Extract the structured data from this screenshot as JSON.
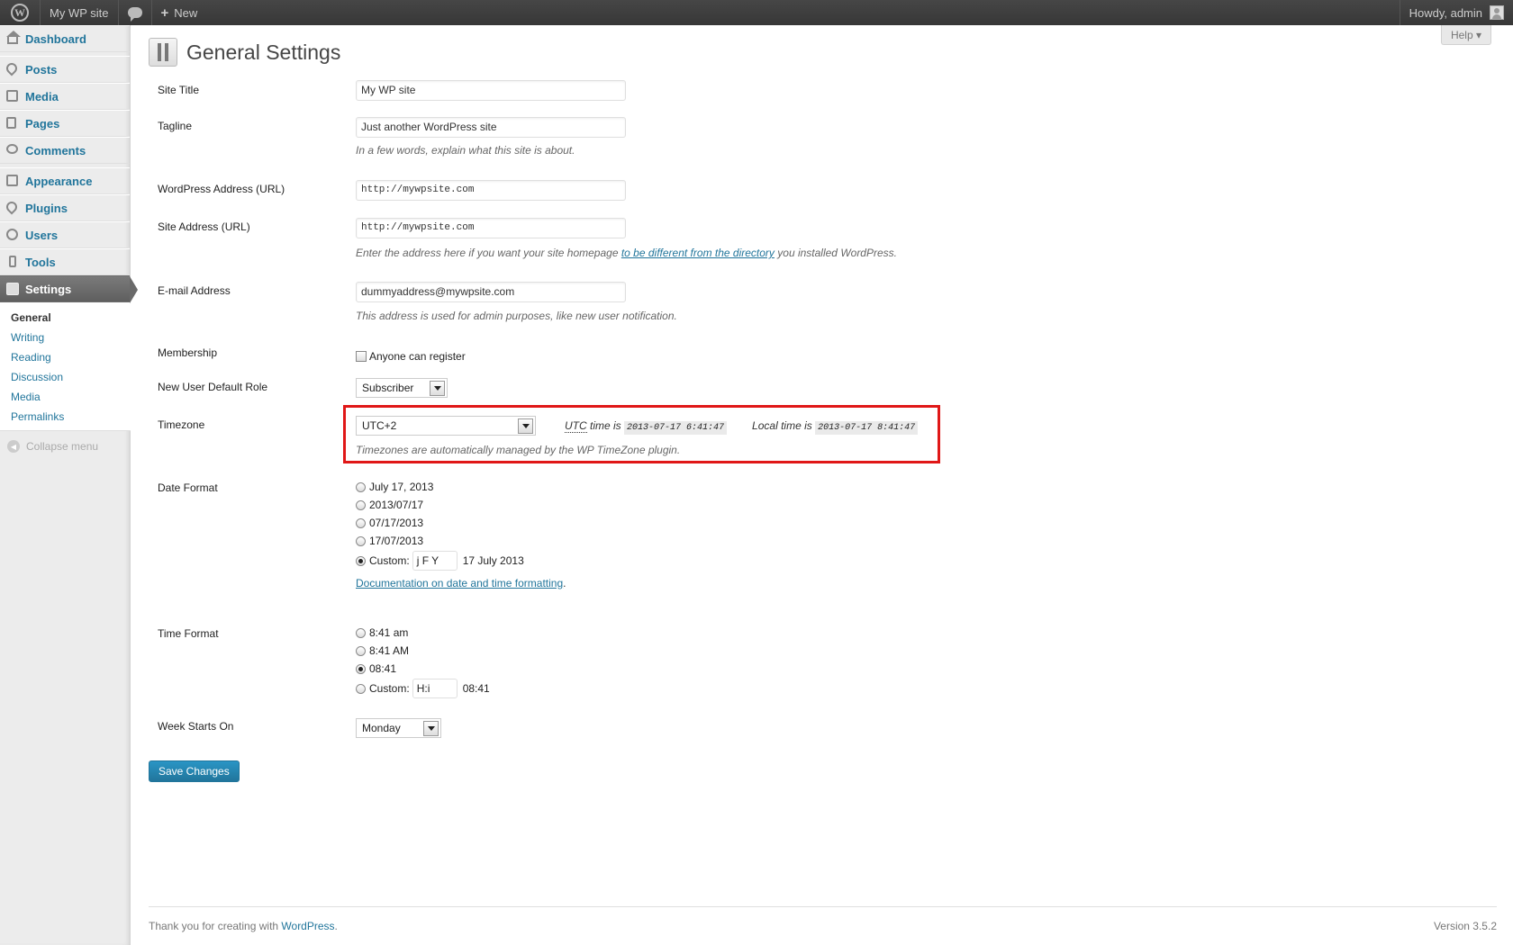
{
  "adminbar": {
    "site_name": "My WP site",
    "new_label": "New",
    "howdy": "Howdy, admin"
  },
  "help": {
    "label": "Help ▾"
  },
  "sidebar": {
    "items": [
      {
        "label": "Dashboard",
        "icon": "home-icon"
      },
      {
        "label": "Posts",
        "icon": "pin-icon"
      },
      {
        "label": "Media",
        "icon": "media-icon"
      },
      {
        "label": "Pages",
        "icon": "pages-icon"
      },
      {
        "label": "Comments",
        "icon": "comment-icon"
      },
      {
        "label": "Appearance",
        "icon": "appearance-icon"
      },
      {
        "label": "Plugins",
        "icon": "plugin-icon"
      },
      {
        "label": "Users",
        "icon": "users-icon"
      },
      {
        "label": "Tools",
        "icon": "tools-icon"
      },
      {
        "label": "Settings",
        "icon": "settings-icon"
      }
    ],
    "submenu": [
      "General",
      "Writing",
      "Reading",
      "Discussion",
      "Media",
      "Permalinks"
    ],
    "collapse": "Collapse menu"
  },
  "page": {
    "title": "General Settings"
  },
  "form": {
    "site_title": {
      "label": "Site Title",
      "value": "My WP site"
    },
    "tagline": {
      "label": "Tagline",
      "value": "Just another WordPress site",
      "desc": "In a few words, explain what this site is about."
    },
    "wp_address": {
      "label": "WordPress Address (URL)",
      "value": "http://mywpsite.com"
    },
    "site_address": {
      "label": "Site Address (URL)",
      "value": "http://mywpsite.com",
      "desc_before": "Enter the address here if you want your site homepage ",
      "desc_link": "to be different from the directory",
      "desc_after": " you installed WordPress."
    },
    "email": {
      "label": "E-mail Address",
      "value": "dummyaddress@mywpsite.com",
      "desc": "This address is used for admin purposes, like new user notification."
    },
    "membership": {
      "label": "Membership",
      "checkbox_label": "Anyone can register",
      "checked": false
    },
    "default_role": {
      "label": "New User Default Role",
      "value": "Subscriber"
    },
    "timezone": {
      "label": "Timezone",
      "value": "UTC+2",
      "utc_label": "UTC",
      "utc_suffix": " time is ",
      "utc_time": "2013-07-17 6:41:47",
      "local_label": "Local time is ",
      "local_time": "2013-07-17 8:41:47",
      "desc": "Timezones are automatically managed by the WP TimeZone plugin."
    },
    "date_format": {
      "label": "Date Format",
      "options": [
        "July 17, 2013",
        "2013/07/17",
        "07/17/2013",
        "17/07/2013"
      ],
      "custom_label": "Custom:",
      "custom_value": "j F Y",
      "custom_preview": "17 July 2013",
      "doc_link": "Documentation on date and time formatting"
    },
    "time_format": {
      "label": "Time Format",
      "options": [
        "8:41 am",
        "8:41 AM",
        "08:41"
      ],
      "custom_label": "Custom:",
      "custom_value": "H:i",
      "custom_preview": "08:41"
    },
    "week_start": {
      "label": "Week Starts On",
      "value": "Monday"
    },
    "save": "Save Changes"
  },
  "footer": {
    "thanks": "Thank you for creating with ",
    "wp_link": "WordPress",
    "version": "Version 3.5.2"
  },
  "colors": {
    "link": "#21759b",
    "highlight_box": "#e01717",
    "button": "#21759b"
  }
}
